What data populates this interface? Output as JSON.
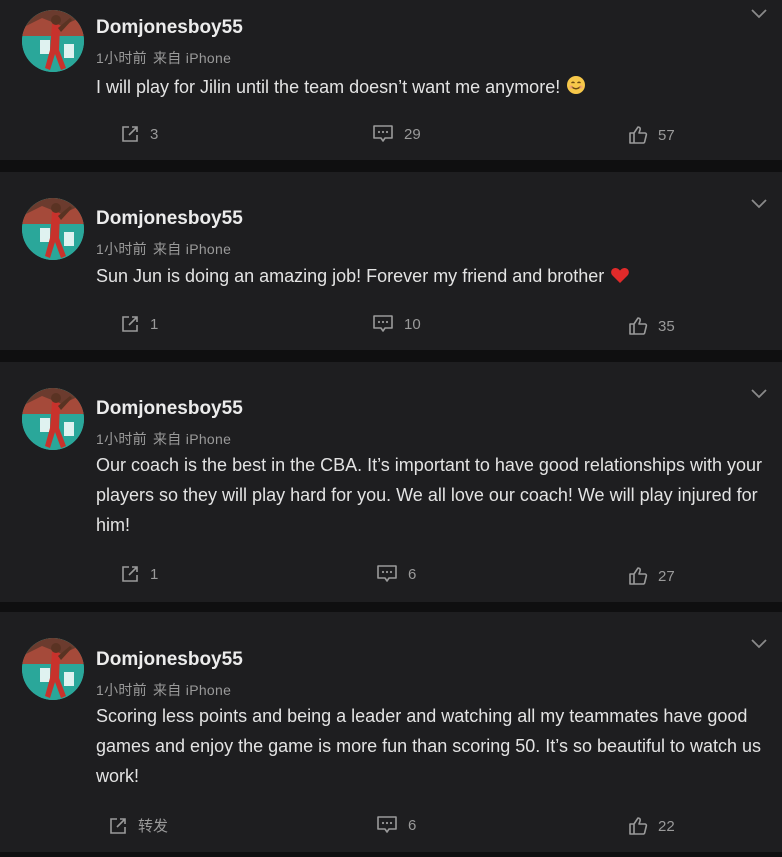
{
  "colors": {
    "background": "#0f0f10",
    "card": "#1e1e20",
    "text": "#e3e3e3",
    "muted": "#9a9a9a",
    "avatar": "#2aa79a"
  },
  "posts": [
    {
      "username": "Domjonesboy55",
      "time": "1小时前",
      "source": "来自 iPhone",
      "text": "I will play for Jilin until the team doesn’t want me anymore!",
      "emoji": "smiling-face-icon",
      "share": "3",
      "comments": "29",
      "likes": "57"
    },
    {
      "username": "Domjonesboy55",
      "time": "1小时前",
      "source": "来自 iPhone",
      "text": "Sun Jun is doing an amazing job! Forever my friend and brother",
      "emoji": "red-heart-icon",
      "share": "1",
      "comments": "10",
      "likes": "35"
    },
    {
      "username": "Domjonesboy55",
      "time": "1小时前",
      "source": "来自 iPhone",
      "text": "Our coach is the best in the CBA. It’s important to have good relationships with your players so they will play hard for you. We all love our coach! We will play injured for him!",
      "share": "1",
      "comments": "6",
      "likes": "27"
    },
    {
      "username": "Domjonesboy55",
      "time": "1小时前",
      "source": "来自 iPhone",
      "text": "Scoring less points and being a leader and watching all my teammates have good games and enjoy the game is more fun than scoring 50. It’s so beautiful to watch us work!",
      "share": "转发",
      "comments": "6",
      "likes": "22"
    }
  ]
}
